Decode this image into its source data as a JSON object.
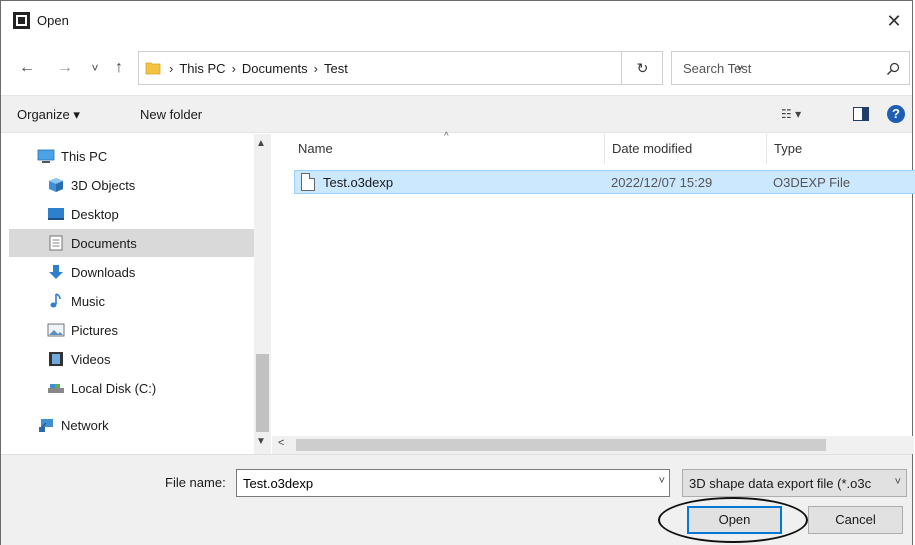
{
  "window": {
    "title": "Open",
    "close_glyph": "✕"
  },
  "nav": {
    "back_glyph": "←",
    "forward_glyph": "→",
    "recent_glyph": "˅",
    "up_glyph": "↑"
  },
  "address": {
    "crumbs": [
      "This PC",
      "Documents",
      "Test"
    ],
    "separator": "›",
    "dropdown_glyph": "˅",
    "refresh_glyph": "↻"
  },
  "search": {
    "placeholder": "Search Test"
  },
  "toolbar": {
    "organize_label": "Organize ▾",
    "new_folder_label": "New folder",
    "view_label": "☷ ▾",
    "help_label": "?"
  },
  "sidebar": {
    "items": [
      {
        "label": "This PC",
        "icon": "monitor-icon"
      },
      {
        "label": "3D Objects",
        "icon": "cube-icon"
      },
      {
        "label": "Desktop",
        "icon": "desktop-icon"
      },
      {
        "label": "Documents",
        "icon": "document-icon",
        "selected": true
      },
      {
        "label": "Downloads",
        "icon": "download-arrow-icon"
      },
      {
        "label": "Music",
        "icon": "music-note-icon"
      },
      {
        "label": "Pictures",
        "icon": "pictures-icon"
      },
      {
        "label": "Videos",
        "icon": "film-icon"
      },
      {
        "label": "Local Disk (C:)",
        "icon": "drive-icon"
      },
      {
        "label": "Network",
        "icon": "network-icon"
      }
    ]
  },
  "file_list": {
    "columns": [
      "Name",
      "Date modified",
      "Type"
    ],
    "sort_glyph": "^",
    "rows": [
      {
        "name": "Test.o3dexp",
        "date": "2022/12/07 15:29",
        "type": "O3DEXP File"
      }
    ]
  },
  "footer": {
    "file_name_label": "File name:",
    "file_name_value": "Test.o3dexp",
    "file_type": "3D shape data export file (*.o3c",
    "open_label": "Open",
    "cancel_label": "Cancel"
  },
  "colors": {
    "selection": "#cce8ff",
    "accent": "#0078d7",
    "folder": "#f5c342"
  }
}
